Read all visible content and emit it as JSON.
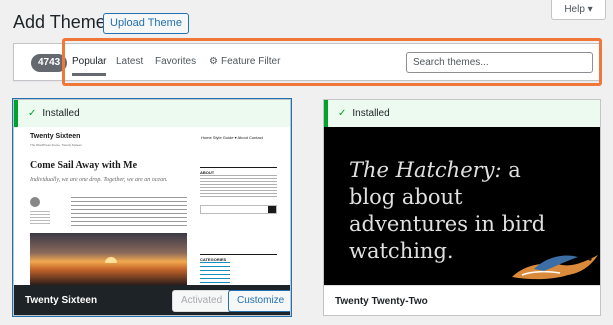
{
  "header": {
    "title": "Add Themes",
    "upload_label": "Upload Theme",
    "help_label": "Help ▾"
  },
  "filter": {
    "count": "4743",
    "tabs": [
      {
        "label": "Popular",
        "active": true
      },
      {
        "label": "Latest"
      },
      {
        "label": "Favorites"
      },
      {
        "label": "Feature Filter",
        "icon": "gear-icon"
      }
    ],
    "search_placeholder": "Search themes..."
  },
  "themes": [
    {
      "installed_label": "Installed",
      "name": "Twenty Sixteen",
      "activated_label": "Activated",
      "customize_label": "Customize",
      "preview": {
        "site_title": "Twenty Sixteen",
        "tagline": "The WordPress theme, Twenty Sixteen",
        "nav": "Home   Style Guide ▾   About   Contact",
        "post_title": "Come Sail Away with Me",
        "post_subtitle": "Individually, we are one drop. Together, we are an ocean.",
        "about_heading": "ABOUT",
        "categories_heading": "CATEGORIES"
      }
    },
    {
      "installed_label": "Installed",
      "name": "Twenty Twenty-Two",
      "preview": {
        "headline_em": "The Hatchery:",
        "headline_rest": " a blog about adventures in bird watching."
      }
    }
  ],
  "colors": {
    "accent": "#2271b1",
    "installed_green": "#00a32a",
    "highlight": "#f0773a"
  }
}
